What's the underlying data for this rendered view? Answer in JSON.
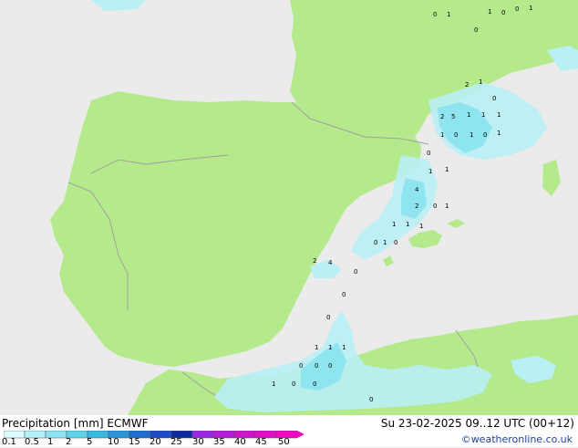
{
  "title": {
    "label": "Precipitation [mm]",
    "model": "ECMWF"
  },
  "datetime": "Su 23-02-2025 09..12 UTC (00+12)",
  "credit": "©weatheronline.co.uk",
  "colors": {
    "sea": "#ebebeb",
    "land": "#b5ea8c",
    "border": "#a0a0a0",
    "precip_light": "#b8f0f5",
    "precip_mid": "#8ee4ef",
    "precip_heavy": "#5cc8e3"
  },
  "legend": {
    "ticks": [
      "0.1",
      "0.5",
      "1",
      "2",
      "5",
      "10",
      "15",
      "20",
      "25",
      "30",
      "35",
      "40",
      "45",
      "50"
    ],
    "colors": [
      "#dcfbff",
      "#b4f0f8",
      "#8ce4f1",
      "#5fd3ea",
      "#39b8e0",
      "#2a95d8",
      "#1f6fd0",
      "#1b4ac4",
      "#0e2a9c",
      "#9a26e0",
      "#b51dd6",
      "#cc14cc",
      "#e10ec8",
      "#f00ac0"
    ]
  },
  "precip_values": [
    "1",
    "0",
    "0",
    "1",
    "0",
    "1",
    "0",
    "2",
    "1",
    "0",
    "2",
    "5",
    "1",
    "1",
    "1",
    "1",
    "0",
    "1",
    "0",
    "1",
    "0",
    "1",
    "1",
    "4",
    "2",
    "0",
    "1",
    "1",
    "1",
    "1",
    "0",
    "1",
    "0",
    "2",
    "4",
    "0",
    "0",
    "0",
    "1",
    "1",
    "1",
    "0",
    "0",
    "0",
    "1",
    "0",
    "0",
    "0"
  ]
}
